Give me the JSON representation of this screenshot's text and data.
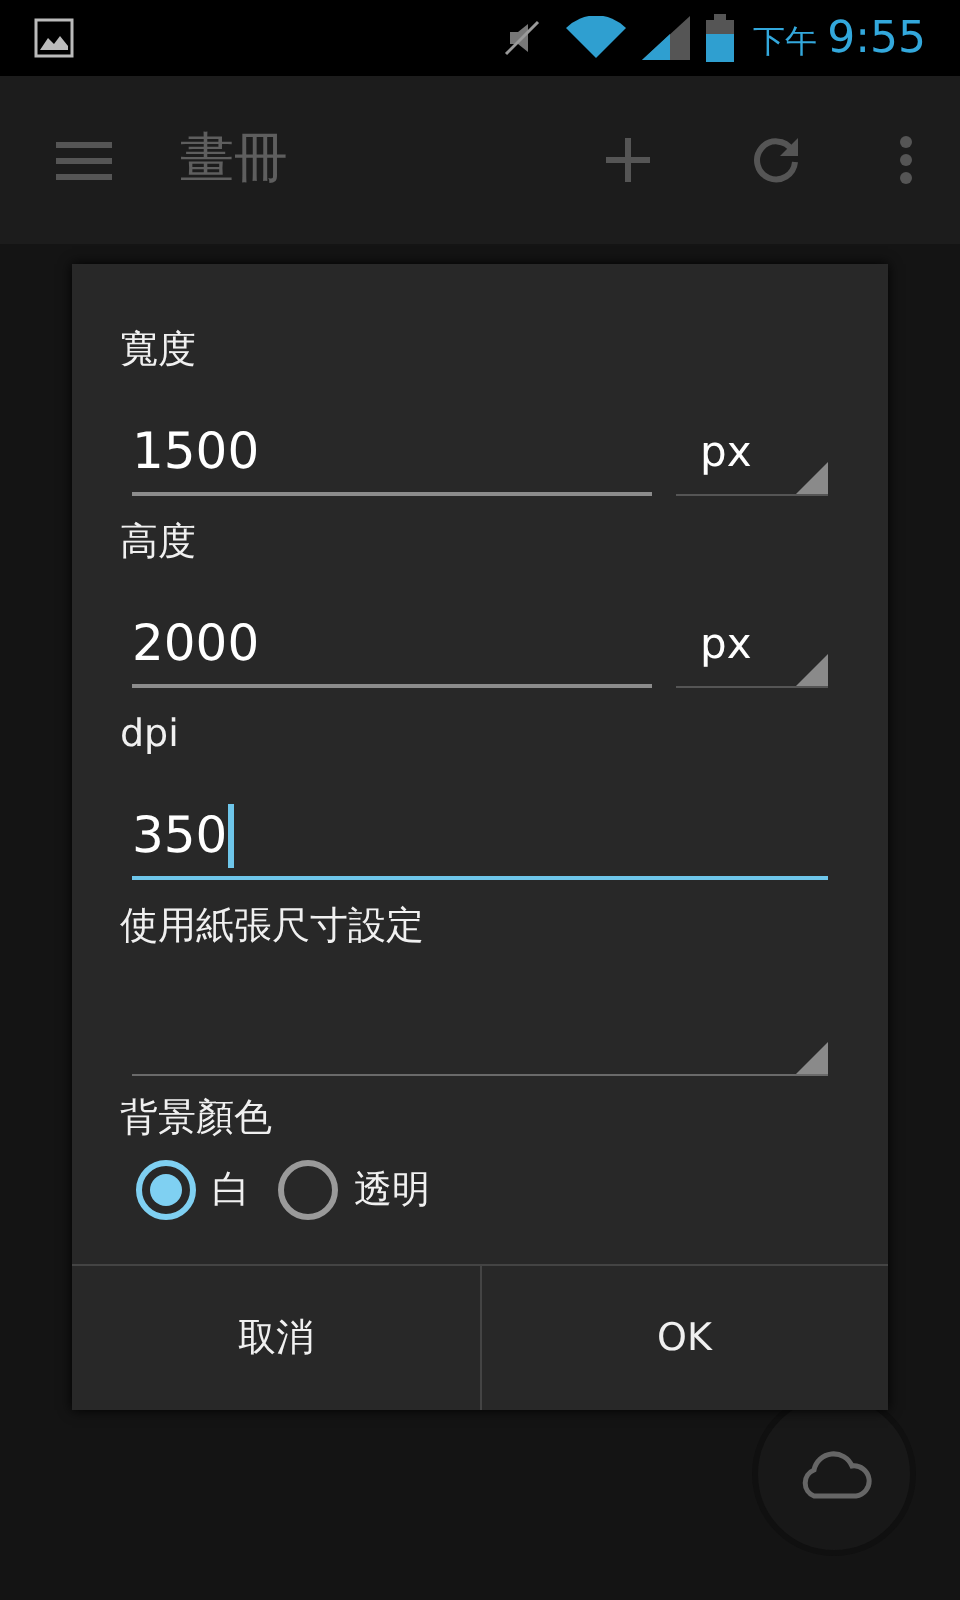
{
  "status_bar": {
    "time_prefix": "下午",
    "time": "9:55"
  },
  "action_bar": {
    "title": "畫冊"
  },
  "dialog": {
    "fields": [
      {
        "kind": "number",
        "label": "寬度",
        "value": "1500",
        "unit": "px",
        "focused": false
      },
      {
        "kind": "number",
        "label": "高度",
        "value": "2000",
        "unit": "px",
        "focused": false
      },
      {
        "kind": "text",
        "label": "dpi",
        "value": "350",
        "focused": true
      },
      {
        "kind": "select",
        "label": "使用紙張尺寸設定"
      }
    ],
    "background_color": {
      "label": "背景顏色",
      "options": [
        {
          "label": "白",
          "selected": true
        },
        {
          "label": "透明",
          "selected": false
        }
      ]
    },
    "buttons": [
      {
        "label": "取消"
      },
      {
        "label": "OK"
      }
    ]
  }
}
